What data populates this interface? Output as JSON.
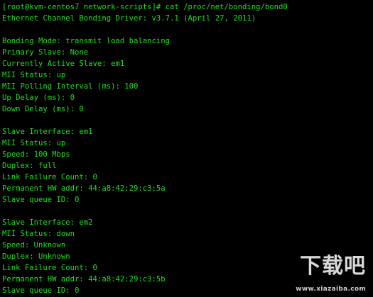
{
  "terminal": {
    "lines": [
      "[root@kvm-centos7 network-scripts]# cat /proc/net/bonding/bond0",
      "Ethernet Channel Bonding Driver: v3.7.1 (April 27, 2011)",
      "",
      "Bonding Mode: transmit load balancing",
      "Primary Slave: None",
      "Currently Active Slave: em1",
      "MII Status: up",
      "MII Polling Interval (ms): 100",
      "Up Delay (ms): 0",
      "Down Delay (ms): 0",
      "",
      "Slave Interface: em1",
      "MII Status: up",
      "Speed: 100 Mbps",
      "Duplex: full",
      "Link Failure Count: 0",
      "Permanent HW addr: 44:a8:42:29:c3:5a",
      "Slave queue ID: 0",
      "",
      "Slave Interface: em2",
      "MII Status: down",
      "Speed: Unknown",
      "Duplex: Unknown",
      "Link Failure Count: 0",
      "Permanent HW addr: 44:a8:42:29:c3:5b",
      "Slave queue ID: 0"
    ],
    "text_color": "#1ee21e",
    "background_color": "#000000"
  },
  "watermark": {
    "logo_text": "下载吧",
    "url_text": "www.xiazaiba.com"
  }
}
